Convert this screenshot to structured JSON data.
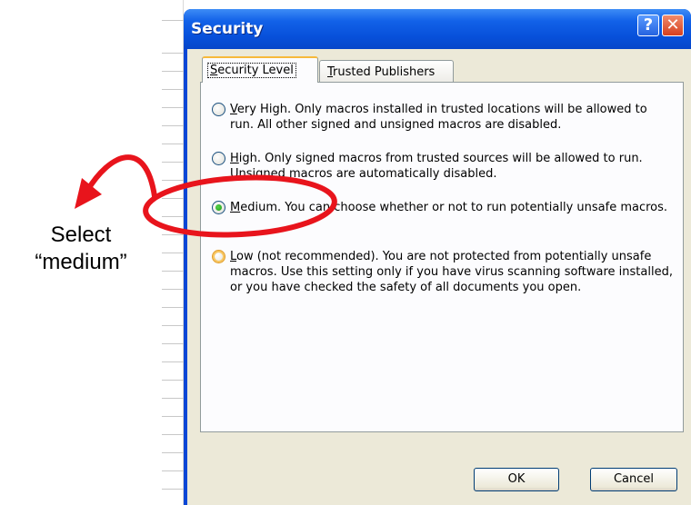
{
  "dialog": {
    "title": "Security",
    "help_glyph": "?",
    "close_glyph": "✕",
    "tabs": [
      {
        "label_prefix": "",
        "label_mnemonic": "S",
        "label_rest": "ecurity Level",
        "active": true
      },
      {
        "label_prefix": "",
        "label_mnemonic": "T",
        "label_rest": "rusted Publishers",
        "active": false
      }
    ],
    "options": [
      {
        "mnemonic": "V",
        "label_rest": "ery High",
        "description": ". Only macros installed in trusted locations will be allowed to run. All other signed and unsigned macros are disabled.",
        "selected": false
      },
      {
        "mnemonic": "H",
        "label_rest": "igh",
        "description": ". Only signed macros from trusted sources will be allowed to run. Unsigned macros are automatically disabled.",
        "selected": false
      },
      {
        "mnemonic": "M",
        "label_rest": "edium",
        "description": ". You can choose whether or not to run potentially unsafe macros.",
        "selected": true
      },
      {
        "mnemonic": "L",
        "label_rest": "ow (not recommended)",
        "description": ". You are not protected from potentially unsafe macros. Use this setting only if you have virus scanning software installed, or you have checked the safety of all documents you open.",
        "selected": false
      }
    ],
    "ok_label": "OK",
    "cancel_label": "Cancel"
  },
  "annotation": {
    "line1": "Select",
    "line2": "“medium”",
    "color": "#e8141c"
  },
  "colors": {
    "titlebar": "#0750da",
    "client": "#ece9d8",
    "active_tab_accent": "#f7b93b"
  }
}
